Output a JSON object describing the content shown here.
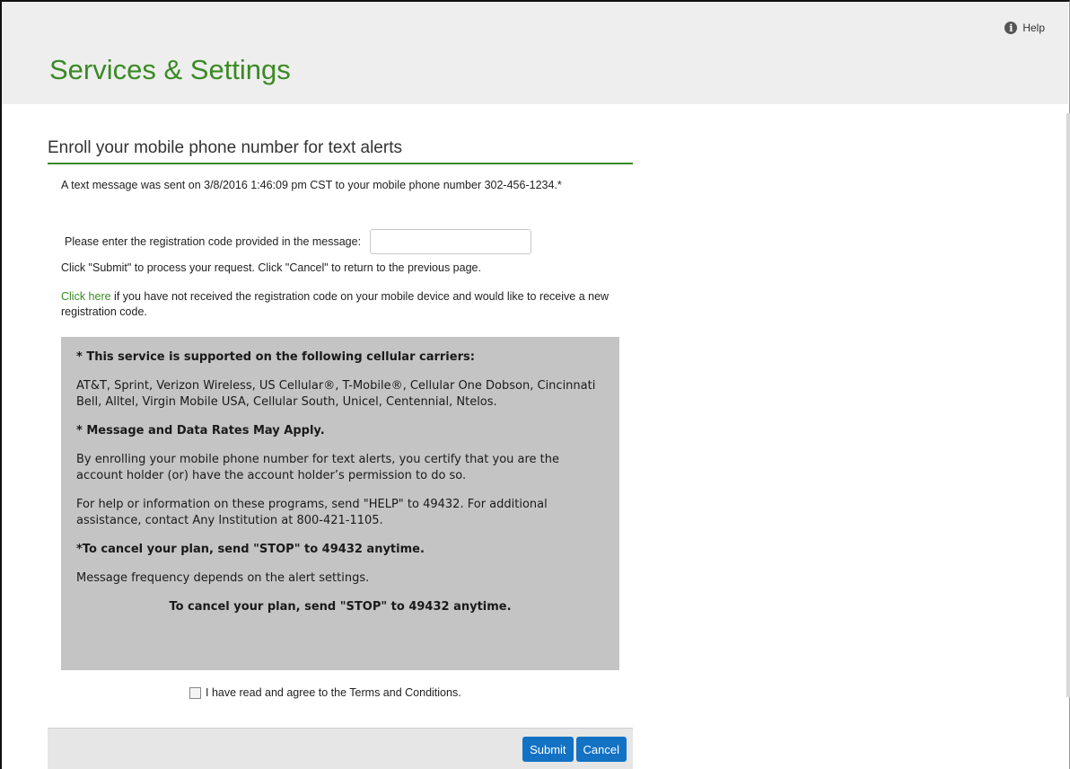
{
  "header": {
    "help_label": "Help",
    "help_icon": "info-circle-icon",
    "title": "Services & Settings"
  },
  "section": {
    "title": "Enroll your mobile phone number for text alerts"
  },
  "sent_message": "A text message was sent on 3/8/2016 1:46:09 pm CST to your mobile phone number 302-456-1234.*",
  "registration": {
    "label": "Please enter the registration code provided in the message:",
    "value": "",
    "placeholder": ""
  },
  "submit_instructions": "Click \"Submit\" to process your request. Click \"Cancel\" to return to the previous page.",
  "resend": {
    "link_text": "Click here",
    "rest_text": " if you have not received the registration code on your mobile device and would like to receive a new registration code."
  },
  "info_box": {
    "carriers_heading": "* This service is supported on the following cellular carriers:",
    "carriers_list": "AT&T, Sprint, Verizon Wireless, US Cellular®, T-Mobile®, Cellular One Dobson, Cincinnati Bell, Alltel, Virgin Mobile USA, Cellular South, Unicel, Centennial, Ntelos.",
    "rates_heading": "* Message and Data Rates May Apply.",
    "certify_text": "By enrolling your mobile phone number for text alerts, you certify that you are the account holder (or) have the account holder’s permission to do so.",
    "help_text": "For help or information on these programs, send \"HELP\" to 49432. For additional assistance, contact Any Institution at 800-421-1105.",
    "cancel_heading": "*To cancel your plan, send \"STOP\" to 49432 anytime.",
    "frequency_text": "Message frequency depends on the alert settings.",
    "cancel_centered": "To cancel your plan, send \"STOP\" to 49432 anytime."
  },
  "terms": {
    "label": "I have read and agree to the Terms and Conditions.",
    "checked": false
  },
  "buttons": {
    "submit": "Submit",
    "cancel": "Cancel"
  },
  "colors": {
    "accent_green": "#3a8a24",
    "button_blue": "#1372c4",
    "info_box_bg": "#c4c4c4",
    "header_bg": "#eeeeee"
  }
}
